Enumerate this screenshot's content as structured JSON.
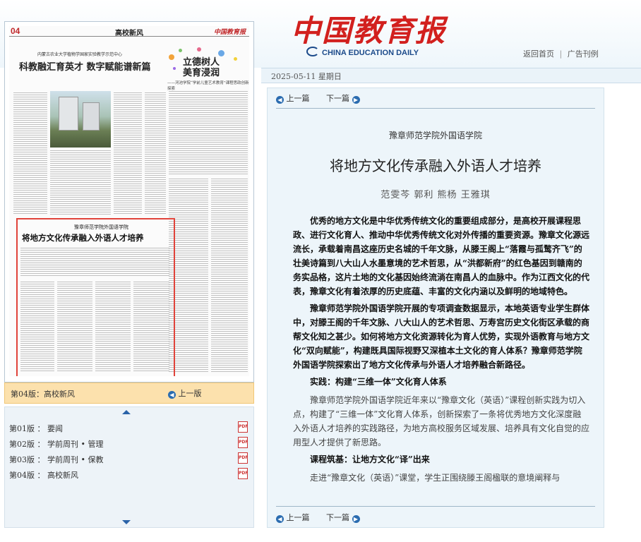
{
  "header": {
    "logo_cn": "中国教育报",
    "logo_en": "CHINA EDUCATION DAILY",
    "link_home": "返回首页",
    "separator": "|",
    "link_ads": "广告刊例",
    "date": "2025-05-11  星期日"
  },
  "paper": {
    "page_no": "04",
    "section": "高校新风",
    "brand": "中国教育报",
    "sub_left": "内蒙古农业大学植物学国家实验教学示范中心",
    "headline_left": "科教融汇育英才 数字赋能谱新篇",
    "headline_right": "立德树人\n美育浸润",
    "headline_right_sub": "——河池学院“学前儿童艺术教育”课程思政创新探索",
    "boxed_sub": "豫章师范学院外国语学院",
    "boxed_title": "将地方文化传承融入外语人才培养"
  },
  "pagebar": {
    "current": "第04版：高校新风",
    "prev": "上一版"
  },
  "pagelist": [
    {
      "label": "第01版 ： 要闻"
    },
    {
      "label": "第02版 ： 学前周刊 • 管理"
    },
    {
      "label": "第03版 ： 学前周刊 • 保教"
    },
    {
      "label": "第04版 ： 高校新风"
    }
  ],
  "pdf_icon_text": "PDF",
  "nav": {
    "prev": "上一篇",
    "next": "下一篇"
  },
  "article": {
    "subtitle": "豫章师范学院外国语学院",
    "title": "将地方文化传承融入外语人才培养",
    "authors": "范雯芩  郭利  熊杨  王雅琪",
    "paragraphs": [
      {
        "type": "lead",
        "text": "优秀的地方文化是中华优秀传统文化的重要组成部分，是高校开展课程思政、进行文化育人、推动中华优秀传统文化对外传播的重要资源。豫章文化源远流长，承载着南昌这座历史名城的千年文脉，从滕王阁上“落霞与孤鹜齐飞”的壮美诗篇到八大山人水墨意境的艺术哲思，从“洪都新府”的红色基因到赣南的务实品格，这片土地的文化基因始终流淌在南昌人的血脉中。作为江西文化的代表，豫章文化有着浓厚的历史底蕴、丰富的文化内涵以及鲜明的地域特色。"
      },
      {
        "type": "lead",
        "text": "豫章师范学院外国语学院开展的专项调查数据显示，本地英语专业学生群体中，对滕王阁的千年文脉、八大山人的艺术哲思、万寿宫历史文化街区承载的商帮文化知之甚少。如何将地方文化资源转化为育人优势，实现外语教育与地方文化“双向赋能”，构建既具国际视野又深植本土文化的育人体系？豫章师范学院外国语学院探索出了地方文化传承与外语人才培养融合新路径。"
      },
      {
        "type": "heading",
        "text": "实践：构建“三维一体”文化育人体系"
      },
      {
        "type": "normal",
        "text": "豫章师范学院外国语学院近年来以“豫章文化（英语）”课程创新实践为切入点，构建了“三维一体”文化育人体系，创新探索了一条将优秀地方文化深度融入外语人才培养的实践路径，为地方高校服务区域发展、培养具有文化自觉的应用型人才提供了新思路。"
      },
      {
        "type": "heading",
        "text": "课程筑基：让地方文化“译”出来"
      },
      {
        "type": "normal",
        "text": "走进“豫章文化（英语）”课堂，学生正围绕滕王阁楹联的意境阐释与"
      }
    ]
  },
  "colors": {
    "accent_red": "#d2201e",
    "brand_blue": "#1b4a8a",
    "pagebar_bg": "#fce1ad",
    "article_bg": "#edf5fa",
    "highlight_box": "#e0433a"
  }
}
